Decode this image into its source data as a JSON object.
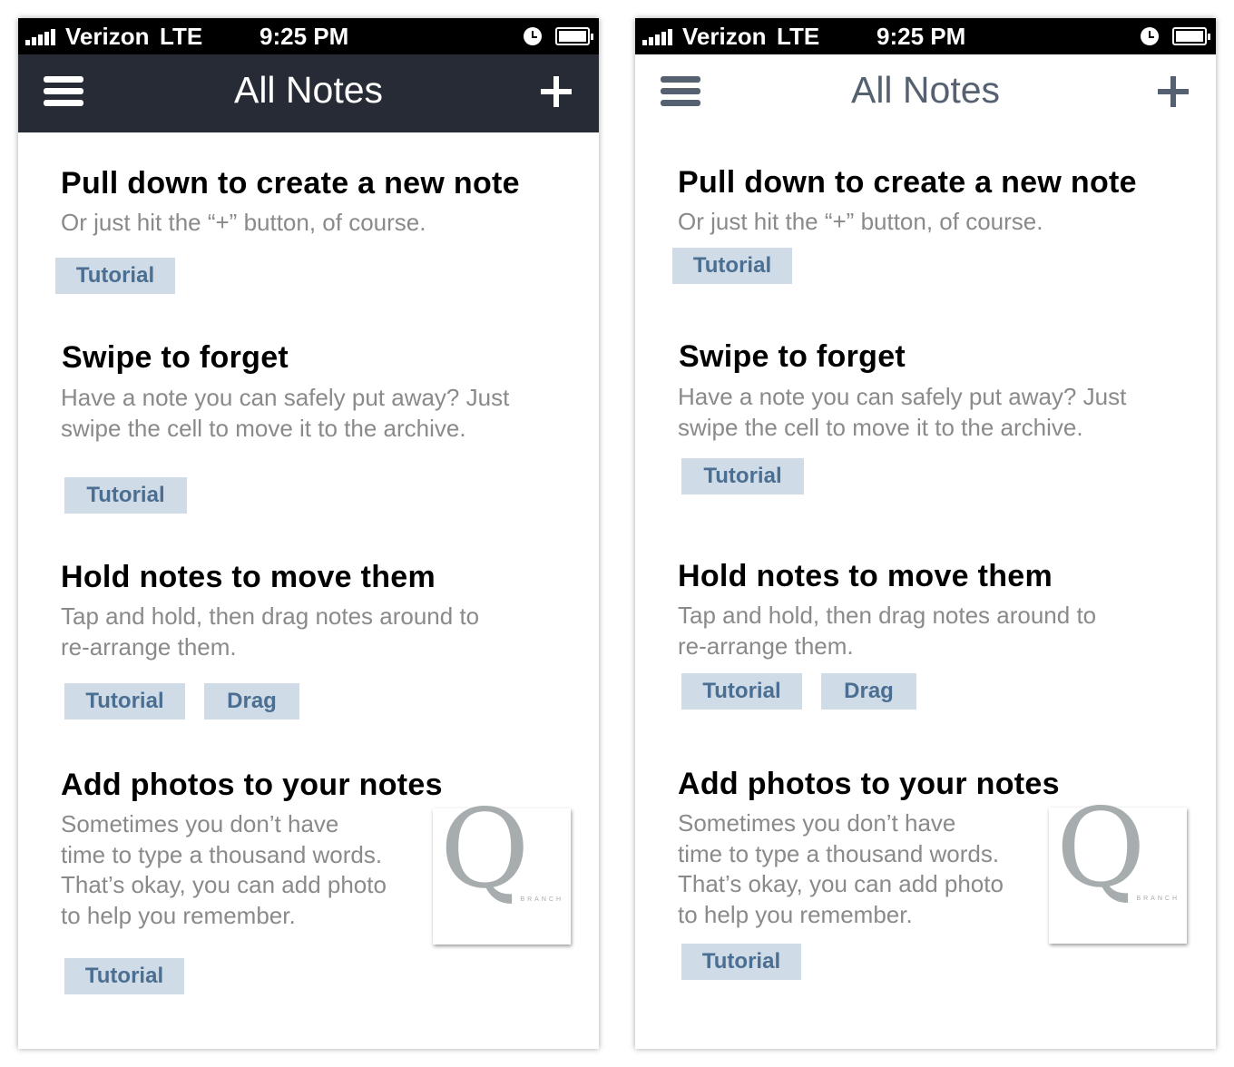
{
  "status_bar": {
    "carrier": "Verizon",
    "network": "LTE",
    "time": "9:25 PM"
  },
  "nav": {
    "title": "All Notes",
    "menu_icon": "hamburger-menu-icon",
    "add_icon": "plus-icon"
  },
  "notes": [
    {
      "title": "Pull down to create a new note",
      "body": [
        "Or just hit the “+” button, of course."
      ],
      "tags": [
        "Tutorial"
      ]
    },
    {
      "title": "Swipe to forget",
      "body": [
        "Have a note you can safely put away? Just",
        "swipe the cell to move it to the archive."
      ],
      "tags": [
        "Tutorial"
      ]
    },
    {
      "title": "Hold notes to move them",
      "body": [
        "Tap and hold, then drag notes around to",
        "re-arrange them."
      ],
      "tags": [
        "Tutorial",
        "Drag"
      ]
    },
    {
      "title": "Add photos to your notes",
      "body": [
        "Sometimes you don’t have",
        "time to type a thousand words.",
        "That’s okay, you can add photo",
        "to help you remember."
      ],
      "tags": [
        "Tutorial"
      ],
      "photo": {
        "letter": "Q",
        "word": "BRANCH"
      }
    }
  ],
  "colors": {
    "nav_dark_bg": "#262b35",
    "nav_light_fg": "#556071",
    "tag_bg": "#cfdbe6",
    "tag_fg": "#4b6f92",
    "body_text": "#8a8a8a"
  }
}
